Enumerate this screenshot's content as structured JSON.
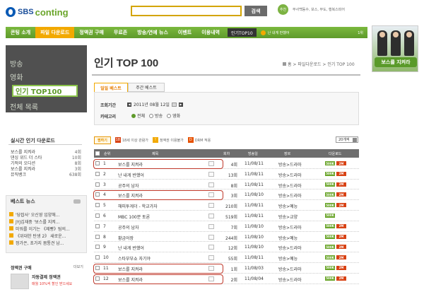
{
  "header": {
    "logo_sbs": "SBS",
    "logo_conting": "conting",
    "search_button": "검색",
    "hot_badge": "추천",
    "hot_text": "무사백동수, 보스, 무도, 행복스피어"
  },
  "nav": {
    "items": [
      {
        "label": "콘팅 소개",
        "active": false
      },
      {
        "label": "파일 다운로드",
        "active": true
      },
      {
        "label": "정액권 구매",
        "active": false
      },
      {
        "label": "무료존",
        "active": false
      },
      {
        "label": "방송/연예 뉴스",
        "active": false
      },
      {
        "label": "이벤트",
        "active": false
      },
      {
        "label": "이용내역",
        "active": false
      }
    ],
    "top100_label": "인기TOP10",
    "notice": "난 내게 반했어",
    "count": "1위"
  },
  "banner": {
    "title": "보스를 지켜라"
  },
  "sidebar": {
    "items": [
      "방송",
      "영화"
    ],
    "active": "인기 TOP100",
    "item_all": "전체 목록"
  },
  "realtime": {
    "title": "실시간 인기 다운로드",
    "items": [
      {
        "title": "보스를 지켜라",
        "ep": "4회"
      },
      {
        "title": "댄싱 위드 더 스타",
        "ep": "10회"
      },
      {
        "title": "기적의 오디션",
        "ep": "8회"
      },
      {
        "title": "보스를 지켜라",
        "ep": "3회"
      },
      {
        "title": "뮤직뱅크",
        "ep": "638회"
      }
    ]
  },
  "best_news": {
    "title": "베스트 뉴스",
    "items": [
      "'당잡사' 오신영 입양해...",
      "JYJ김재중 '보스를 지켜...",
      "미워를 이기는 《제빵》팀의...",
      "《위대한 탄생 2》 새로운...",
      "정가은, 초가지 몸통견 남..."
    ]
  },
  "coupon": {
    "title": "정액권 구매",
    "more": "더보기",
    "line1": "자동결제 정액권",
    "line2": "매월 10%씩 할인 받으세요"
  },
  "page": {
    "title": "인기 TOP 100",
    "breadcrumb": "홈 > 파일다운로드 > 인기 TOP 100"
  },
  "tabs": {
    "daily": "일일 베스트",
    "weekly": "주간 베스트"
  },
  "filter": {
    "period_label": "조회기간",
    "period_value": "2011년 08월 12일",
    "category_label": "카테고리",
    "options": [
      {
        "label": "전체",
        "selected": true
      },
      {
        "label": "방송",
        "selected": false
      },
      {
        "label": "영화",
        "selected": false
      }
    ]
  },
  "tools": {
    "gift_button": "찜하기",
    "legend_18": "18세 이상 관람가",
    "legend_member": "정액권 이용불가",
    "legend_drm": "DRM 적용",
    "sort_value": "20개씩"
  },
  "table": {
    "headers": {
      "rank": "순위",
      "title": "제목",
      "count": "회차",
      "date": "방송일",
      "genre": "장르",
      "download": "다운로드"
    },
    "rows": [
      {
        "rank": "1",
        "title": "보스를 지켜라",
        "count": "4회",
        "date": "11/08/11",
        "genre": "방송>드라마",
        "hd": "500K",
        "sd": "2M",
        "highlight": true
      },
      {
        "rank": "2",
        "title": "난 내게 반했어",
        "count": "13회",
        "date": "11/08/11",
        "genre": "방송>드라마",
        "hd": "500K",
        "sd": "2M",
        "highlight": false
      },
      {
        "rank": "3",
        "title": "공주의 남자",
        "count": "8회",
        "date": "11/08/11",
        "genre": "방송>드라마",
        "hd": "500K",
        "sd": "2M",
        "highlight": false
      },
      {
        "rank": "4",
        "title": "보스를 지켜라",
        "count": "3회",
        "date": "11/08/10",
        "genre": "방송>드라마",
        "hd": "500K",
        "sd": "2M",
        "highlight": true
      },
      {
        "rank": "5",
        "title": "해피투게더 - 학교가자",
        "count": "210회",
        "date": "11/08/11",
        "genre": "방송>예능",
        "hd": "500K",
        "sd": "2M",
        "highlight": false
      },
      {
        "rank": "6",
        "title": "MBC 100분 토론",
        "count": "519회",
        "date": "11/08/11",
        "genre": "방송>교양",
        "hd": "500K",
        "sd": "",
        "highlight": false
      },
      {
        "rank": "7",
        "title": "공주의 남자",
        "count": "7회",
        "date": "11/08/10",
        "genre": "방송>드라마",
        "hd": "500K",
        "sd": "2M",
        "highlight": false
      },
      {
        "rank": "8",
        "title": "황금어장",
        "count": "244회",
        "date": "11/08/10",
        "genre": "방송>예능",
        "hd": "500K",
        "sd": "2M",
        "highlight": false
      },
      {
        "rank": "9",
        "title": "난 내게 반했어",
        "count": "12회",
        "date": "11/08/10",
        "genre": "방송>드라마",
        "hd": "500K",
        "sd": "2M",
        "highlight": false
      },
      {
        "rank": "10",
        "title": "스타부부쇼 자기야",
        "count": "55회",
        "date": "11/08/11",
        "genre": "방송>예능",
        "hd": "500K",
        "sd": "2M",
        "highlight": false
      },
      {
        "rank": "11",
        "title": "보스를 지켜라",
        "count": "1회",
        "date": "11/08/03",
        "genre": "방송>드라마",
        "hd": "500K",
        "sd": "2M",
        "highlight": true
      },
      {
        "rank": "12",
        "title": "보스를 지켜라",
        "count": "2회",
        "date": "11/08/04",
        "genre": "방송>드라마",
        "hd": "500K",
        "sd": "2M",
        "highlight": true
      }
    ]
  }
}
